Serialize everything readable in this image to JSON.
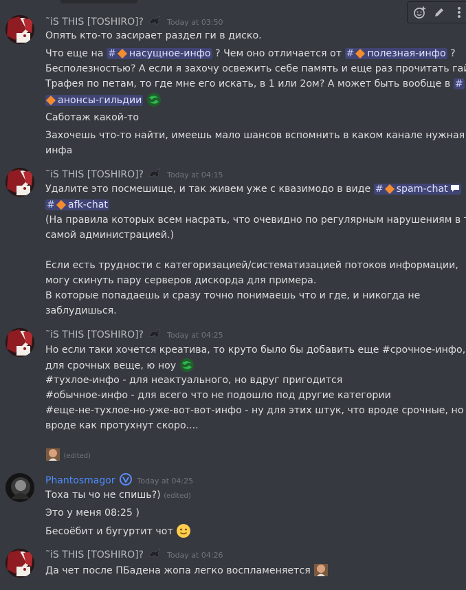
{
  "toolbar": {
    "add_reaction": "add-reaction",
    "edit": "edit",
    "more": "more"
  },
  "colors": {
    "background": "#36393f",
    "mention_bg": "#4a4f7a",
    "timestamp": "#72767d",
    "phantos_name": "#4e8cff"
  },
  "messages": [
    {
      "user": "˜iS THIS [TOSHIRO]?",
      "time": "Today at 03:50",
      "lines": {
        "l1": "Опять кто-то засирает раздел ги в диско.",
        "l2a": "Что еще на ",
        "m1": "насущное-инфо",
        "l2b": " ? Чем оно отличается от ",
        "m2": "полезная-инфо",
        "l2c": " ?",
        "l3": "Бесполезностью? А если я захочу освежить себе память и еще раз прочитать гайд",
        "l4a": "Трафея по петам, то где мне его искать, в 1 или 2ом? А может быть вообще в ",
        "m3": "анонсы-гильдии",
        "l6": "Саботаж какой-то",
        "l7": "Захочешь что-то найти, имеешь мало шансов вспомнить в каком канале нужная",
        "l8": "инфа"
      }
    },
    {
      "user": "˜iS THIS [TOSHIRO]?",
      "time": "Today at 04:15",
      "lines": {
        "l1a": "Удалите это посмешище, и так живем уже с квазимодо в виде ",
        "m1": "spam-chat",
        "m2": "afk-chat",
        "l3": "(На правила которых всем насрать, что очевидно по регулярным нарушениям в т.ч.",
        "l4": "самой администрацией.)",
        "l5": "Если есть трудности с категоризацией/систематизацией потоков информации,",
        "l6": "могу скинуть пару серверов дискорда для примера.",
        "l7": "В которые попадаешь и сразу точно понимаешь что и где, и никогда не",
        "l8": "заблудишься."
      }
    },
    {
      "user": "˜iS THIS [TOSHIRO]?",
      "time": "Today at 04:25",
      "lines": {
        "l1": "Но если таки хочется креатива, то круто было бы добавить еще #срочное-инфо, ну",
        "l2": "для срочных веще, ю ноу",
        "l3": "#тухлое-инфо - для неактуального, но вдруг пригодится",
        "l4": "#обычное-инфо - для всего что не подошло под другие категории",
        "l5": "#еще-не-тухлое-но-уже-вот-вот-инфо - ну для этих штук, что вроде срочные, но",
        "l6": "вроде как протухнут скоро....",
        "edited": "(edited)"
      }
    },
    {
      "user": "Phantosmagor",
      "time": "Today at 04:25",
      "lines": {
        "l1": "Тоха ты чо не спишь?)",
        "edited": "(edited)",
        "l2": "Это у меня 08:25 )",
        "l3": "Бесоёбит и бугуртит чот"
      }
    },
    {
      "user": "˜iS THIS [TOSHIRO]?",
      "time": "Today at 04:26",
      "lines": {
        "l1": "Да чет после ПБадена жопа легко воспламеняется"
      }
    }
  ]
}
